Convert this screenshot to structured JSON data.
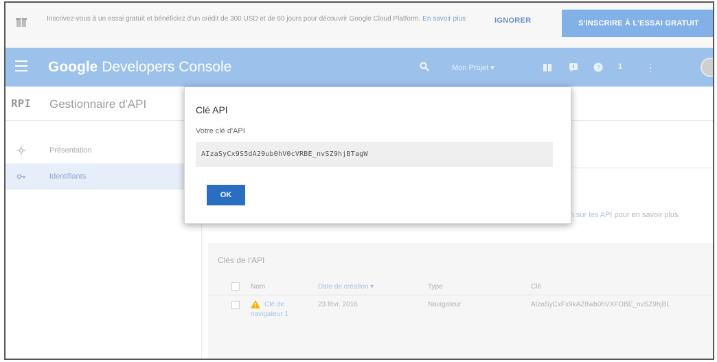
{
  "promo": {
    "message": "Inscrivez-vous à un essai gratuit et bénéficiez d'un crédit de 300 USD et de 60 jours pour découvrir Google Cloud Platform.",
    "learn_more": "En savoir plus",
    "ignore_label": "IGNORER",
    "trial_label": "S'INSCRIRE À L'ESSAI GRATUIT"
  },
  "header": {
    "brand_google": "Google",
    "brand_product": "Developers Console",
    "project_label": "Mon Projet ▾",
    "notification_count": "1"
  },
  "titlebar": {
    "api_label": "RPI",
    "page_title": "Gestionnaire d'API"
  },
  "sidebar": {
    "items": [
      {
        "label": "Présentation",
        "icon": "api-overview-icon"
      },
      {
        "label": "Identifiants",
        "icon": "key-icon"
      }
    ]
  },
  "main": {
    "info_text_prefix": "",
    "info_text_link": "rm sur les API",
    "info_text_suffix": " pour en savoir plus"
  },
  "api_keys_panel": {
    "title": "Clés de l'API",
    "columns": [
      "Nom",
      "Date de création ▾",
      "Type",
      "Clé"
    ],
    "rows": [
      {
        "name_line1": "Clé de",
        "name_line2": "navigateur 1",
        "date": "23 févr. 2016",
        "type": "Navigateur",
        "key": "AIzaSyCxFx9kAZ8wb0hVXFOBE_nvSZ9hjBL"
      }
    ]
  },
  "dialog": {
    "title": "Clé API",
    "label": "Votre clé d'API",
    "key_value": "AIzaSyCx9S5dA29ub0hV0cVRBE_nvSZ9hjBTagW",
    "ok_label": "OK"
  },
  "colors": {
    "header_blue": "#9cc2ec",
    "ok_button": "#2a6ec2",
    "trial_button": "#82b1e8"
  }
}
